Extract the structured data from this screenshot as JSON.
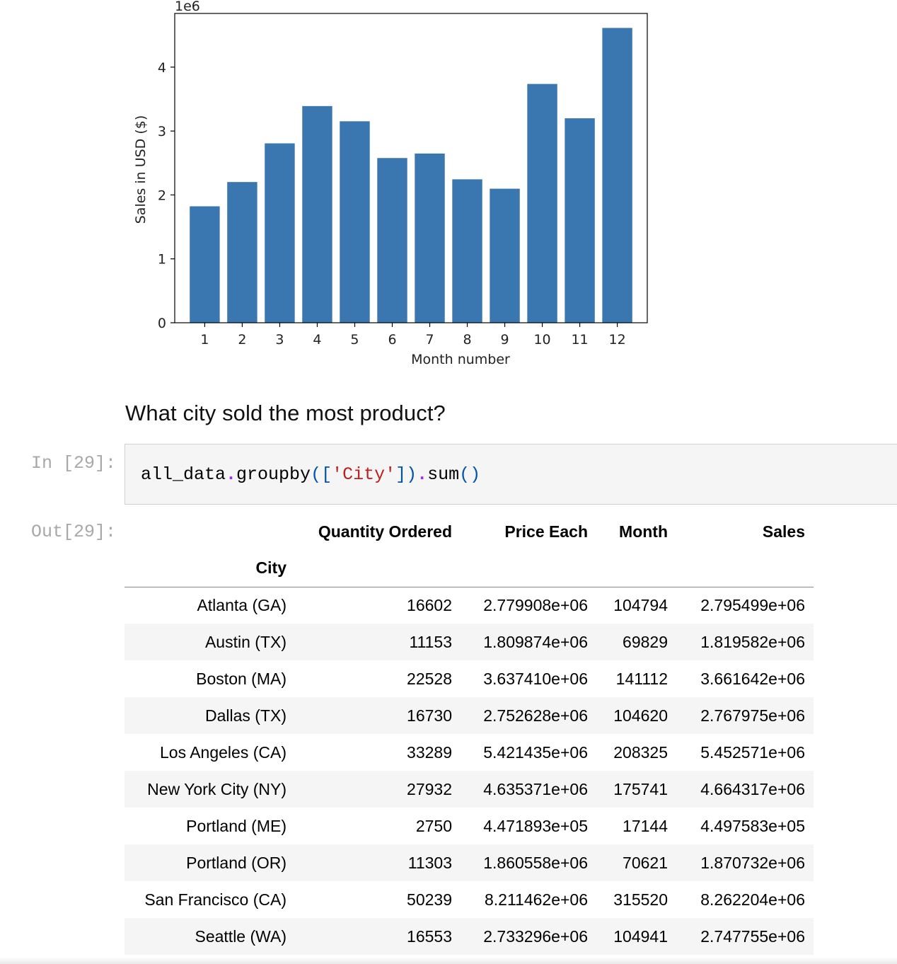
{
  "chart_data": {
    "type": "bar",
    "categories": [
      "1",
      "2",
      "3",
      "4",
      "5",
      "6",
      "7",
      "8",
      "9",
      "10",
      "11",
      "12"
    ],
    "values": [
      1822256,
      2202022,
      2807100,
      3390670,
      3152607,
      2577802,
      2647776,
      2244468,
      2097560,
      3736727,
      3199603,
      4613443
    ],
    "xlabel": "Month number",
    "ylabel": "Sales in USD ($)",
    "offset_text": "1e6",
    "yticks": [
      0,
      1,
      2,
      3,
      4
    ],
    "ylim": [
      0,
      4840000
    ],
    "color": "#3a76af",
    "grid": false
  },
  "markdown": {
    "heading": "What city sold the most product?"
  },
  "cell": {
    "in_prompt": "In [29]:",
    "out_prompt": "Out[29]:",
    "code": {
      "obj": "all_data",
      "dot1": ".",
      "method1": "groupby",
      "open": "([",
      "str": "'City'",
      "close": "])",
      "dot2": ".",
      "method2": "sum",
      "parens": "()"
    }
  },
  "table": {
    "columns": [
      "Quantity Ordered",
      "Price Each",
      "Month",
      "Sales"
    ],
    "index_name": "City",
    "rows": [
      {
        "city": "Atlanta (GA)",
        "qty": "16602",
        "price": "2.779908e+06",
        "month": "104794",
        "sales": "2.795499e+06"
      },
      {
        "city": "Austin (TX)",
        "qty": "11153",
        "price": "1.809874e+06",
        "month": "69829",
        "sales": "1.819582e+06"
      },
      {
        "city": "Boston (MA)",
        "qty": "22528",
        "price": "3.637410e+06",
        "month": "141112",
        "sales": "3.661642e+06"
      },
      {
        "city": "Dallas (TX)",
        "qty": "16730",
        "price": "2.752628e+06",
        "month": "104620",
        "sales": "2.767975e+06"
      },
      {
        "city": "Los Angeles (CA)",
        "qty": "33289",
        "price": "5.421435e+06",
        "month": "208325",
        "sales": "5.452571e+06"
      },
      {
        "city": "New York City (NY)",
        "qty": "27932",
        "price": "4.635371e+06",
        "month": "175741",
        "sales": "4.664317e+06"
      },
      {
        "city": "Portland (ME)",
        "qty": "2750",
        "price": "4.471893e+05",
        "month": "17144",
        "sales": "4.497583e+05"
      },
      {
        "city": "Portland (OR)",
        "qty": "11303",
        "price": "1.860558e+06",
        "month": "70621",
        "sales": "1.870732e+06"
      },
      {
        "city": "San Francisco (CA)",
        "qty": "50239",
        "price": "8.211462e+06",
        "month": "315520",
        "sales": "8.262204e+06"
      },
      {
        "city": "Seattle (WA)",
        "qty": "16553",
        "price": "2.733296e+06",
        "month": "104941",
        "sales": "2.747755e+06"
      }
    ]
  }
}
